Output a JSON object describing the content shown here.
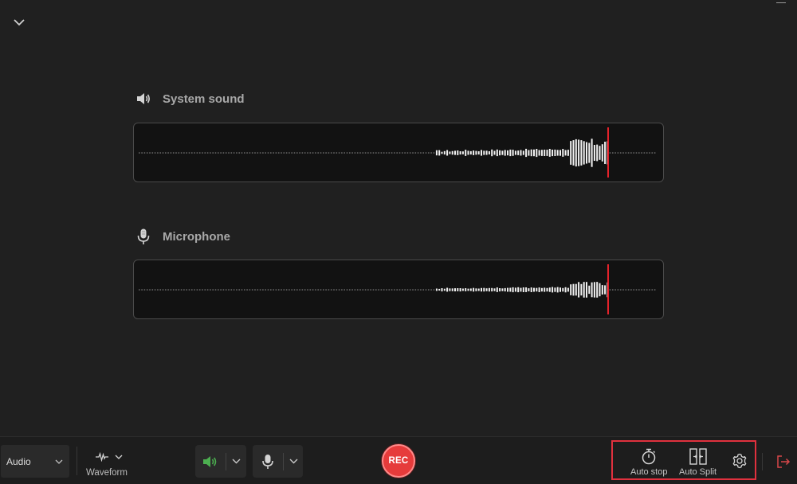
{
  "window": {
    "collapse_icon": "chevron-down-icon",
    "minimize_icon": "minimize-icon"
  },
  "system_sound": {
    "label": "System sound",
    "icon": "speaker-icon",
    "level": 1.0
  },
  "microphone": {
    "label": "Microphone",
    "icon": "microphone-icon",
    "level": 0.55
  },
  "toolbar": {
    "mode": "Audio",
    "view_label": "Waveform",
    "rec_label": "REC",
    "auto_stop_label": "Auto stop",
    "auto_split_label": "Auto Split",
    "settings_icon": "gear-icon",
    "exit_icon": "exit-icon"
  },
  "colors": {
    "background": "#202020",
    "panel": "#121212",
    "accent_red": "#e63b3b",
    "highlight_red": "#e0313e",
    "speaker_green": "#4caf50",
    "playhead": "#e3222a"
  }
}
